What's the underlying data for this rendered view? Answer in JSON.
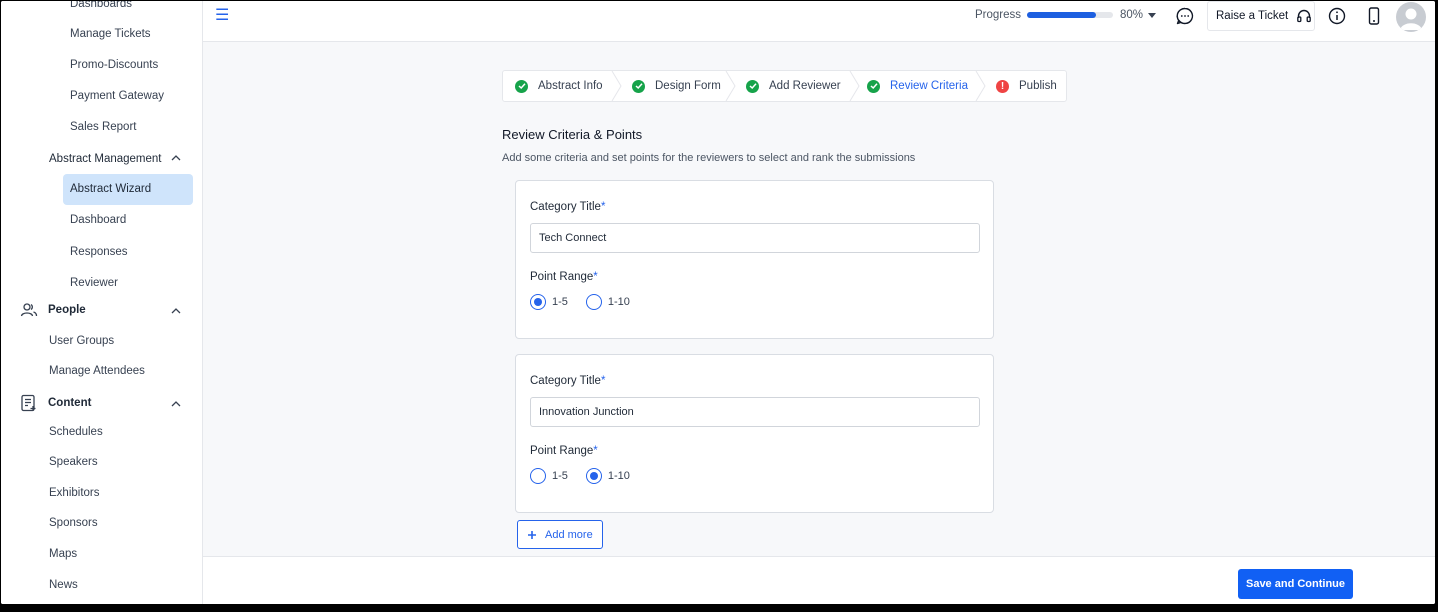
{
  "sidebar": {
    "items": [
      {
        "label": "Dashboards"
      },
      {
        "label": "Manage Tickets"
      },
      {
        "label": "Promo-Discounts"
      },
      {
        "label": "Payment Gateway"
      },
      {
        "label": "Sales Report"
      }
    ],
    "abstract_management": {
      "label": "Abstract Management",
      "items": [
        {
          "label": "Abstract Wizard"
        },
        {
          "label": "Dashboard"
        },
        {
          "label": "Responses"
        },
        {
          "label": "Reviewer"
        }
      ]
    },
    "people": {
      "label": "People",
      "icon": "people-icon",
      "items": [
        {
          "label": "User Groups"
        },
        {
          "label": "Manage Attendees"
        }
      ]
    },
    "content": {
      "label": "Content",
      "icon": "content-icon",
      "items": [
        {
          "label": "Schedules"
        },
        {
          "label": "Speakers"
        },
        {
          "label": "Exhibitors"
        },
        {
          "label": "Sponsors"
        },
        {
          "label": "Maps"
        },
        {
          "label": "News"
        }
      ]
    }
  },
  "topbar": {
    "progress_label": "Progress",
    "progress_value": "80%",
    "progress_fraction": 0.8,
    "raise_ticket_label": "Raise a Ticket"
  },
  "stepper": {
    "steps": [
      {
        "label": "Abstract Info",
        "status": "done"
      },
      {
        "label": "Design Form",
        "status": "done"
      },
      {
        "label": "Add Reviewer",
        "status": "done"
      },
      {
        "label": "Review Criteria",
        "status": "active"
      },
      {
        "label": "Publish",
        "status": "warning"
      }
    ]
  },
  "main": {
    "title": "Review Criteria & Points",
    "description": "Add some criteria and set points for the reviewers to select and rank the submissions",
    "categories": [
      {
        "title_label": "Category Title",
        "title_value": "Tech Connect",
        "range_label": "Point Range",
        "options": [
          "1-5",
          "1-10"
        ],
        "selected": "1-5"
      },
      {
        "title_label": "Category Title",
        "title_value": "Innovation Junction",
        "range_label": "Point Range",
        "options": [
          "1-5",
          "1-10"
        ],
        "selected": "1-10"
      }
    ],
    "add_more_label": "Add more"
  },
  "footer": {
    "save_label": "Save and Continue"
  },
  "colors": {
    "accent": "#1160f4",
    "active_bg": "#cfe4fb",
    "success": "#16a34a",
    "warning": "#ef4444"
  }
}
